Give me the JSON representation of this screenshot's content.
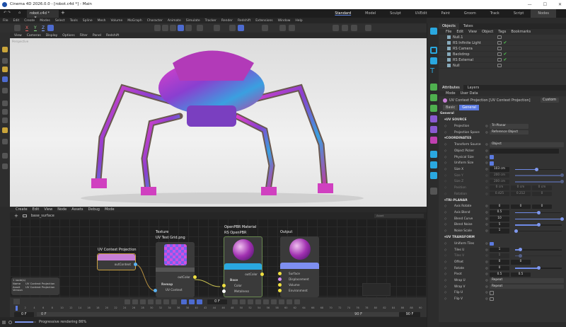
{
  "title": "Cinema 4D 2026.0.0 - [robot.c4d *] - Main",
  "doc_tab": "robot.c4d *",
  "layouts": [
    "Standard",
    "Model",
    "Sculpt",
    "UVEdit",
    "Paint",
    "Groom",
    "Track",
    "Script",
    "Nodes"
  ],
  "menu": [
    "File",
    "Edit",
    "Create",
    "Modes",
    "Select",
    "Tools",
    "Spline",
    "Mesh",
    "Volume",
    "MoGraph",
    "Character",
    "Animate",
    "Simulate",
    "Tracker",
    "Render",
    "Redshift",
    "Extensions",
    "Window",
    "Help"
  ],
  "axis": {
    "x": "X",
    "y": "Y",
    "z": "Z"
  },
  "viewport_menu": [
    "View",
    "Cameras",
    "Display",
    "Options",
    "Filter",
    "Panel",
    "Redshift"
  ],
  "viewport_label": "Perspective",
  "objects": {
    "tabs": [
      "Objects",
      "Takes"
    ],
    "menu": [
      "File",
      "Edit",
      "View",
      "Object",
      "Tags",
      "Bookmarks"
    ],
    "items": [
      {
        "name": "Null.1",
        "check": false
      },
      {
        "name": "RS Infinite Light",
        "check": true
      },
      {
        "name": "RS Camera",
        "check": false
      },
      {
        "name": "Backdrop",
        "check": true
      },
      {
        "name": "RS External",
        "check": true
      },
      {
        "name": "Null",
        "check": false
      }
    ]
  },
  "attributes": {
    "tabs": [
      "Attributes",
      "Layers"
    ],
    "menu": [
      "Mode",
      "User Data"
    ],
    "object": "UV Context Projection [UV Context Projection]",
    "preset": "Custom",
    "subtabs": [
      "Basic",
      "General"
    ],
    "group": "General",
    "uv_source": {
      "title": "UV SOURCE",
      "projection_label": "Projection",
      "projection": "Tri-Planar",
      "space_label": "Projection Space",
      "space": "Reference Object"
    },
    "coordinates": {
      "title": "COORDINATES",
      "transform_source_label": "Transform Source",
      "transform_source": "Object",
      "object_picker_label": "Object Picker",
      "physical_size_label": "Physical Size",
      "uniform_size_label": "Uniform Size",
      "size_x_label": "Size X",
      "size_x": "103 cm",
      "size_y_label": "Size Y",
      "size_y": "200 cm",
      "size_z_label": "Size Z",
      "size_z": "200 cm",
      "position_label": "Position",
      "position": [
        "0 cm",
        "0 cm",
        "0 cm"
      ],
      "rotation_label": "Rotation",
      "rotation": [
        "0.425",
        "0.212",
        "0"
      ]
    },
    "triplanar": {
      "title": "TRI-PLANAR",
      "axis_rotate_label": "Axis Rotate",
      "axis_rotate": [
        "0",
        "0",
        "0"
      ],
      "axis_blend_label": "Axis Blend",
      "axis_blend": "0.5",
      "blend_curve_label": "Blend Curve",
      "blend_curve": "10",
      "blend_noise_label": "Blend Noise",
      "blend_noise": "5",
      "noise_scale_label": "Noise Scale",
      "noise_scale": "1"
    },
    "uv_transform": {
      "title": "UV TRANSFORM",
      "uniform_tiles_label": "Uniform Tiles",
      "tiles_u_label": "Tiles U",
      "tiles_u": "1",
      "tiles_v_label": "Tiles V",
      "tiles_v": "1",
      "offset_label": "Offset",
      "offset": [
        "0",
        "0"
      ],
      "rotate_label": "Rotate",
      "rotate": "0",
      "pivot_label": "Pivot",
      "pivot": [
        "0.5",
        "0.5"
      ],
      "wrap_u_label": "Wrap U",
      "wrap_u": "Repeat",
      "wrap_v_label": "Wrap V",
      "wrap_v": "Repeat",
      "flip_u_label": "Flip U",
      "flip_v_label": "Flip V"
    }
  },
  "node_editor": {
    "menu": [
      "Create",
      "Edit",
      "View",
      "Node",
      "Assets",
      "Debug",
      "Mode"
    ],
    "path": "base_surface",
    "search_placeholder": "Asset",
    "nodes": {
      "uvctx": {
        "title": "UV Context Projection",
        "out": "outContext"
      },
      "texture": {
        "type": "Texture",
        "title": "UV Test Grid.png",
        "out": "outColor",
        "group": "Remap",
        "in": "UV Context"
      },
      "pbr": {
        "type": "OpenPBR Material",
        "title": "RS OpenPBR",
        "out": "outColor",
        "group": "Base",
        "inputs": [
          "Color",
          "Metalness"
        ]
      },
      "output": {
        "title": "Output",
        "inputs": [
          "Surface",
          "Displacement",
          "Volume",
          "Environment"
        ]
      }
    },
    "info": {
      "count": "1 node(s)",
      "name_label": "Name",
      "name": "UV Context Projection",
      "asset_label": "Asset",
      "asset": "UV Context Projection",
      "version_label": "Version"
    }
  },
  "timeline": {
    "ticks": [
      0,
      2,
      4,
      6,
      8,
      10,
      12,
      14,
      16,
      18,
      20,
      22,
      24,
      26,
      28,
      30,
      32,
      34,
      36,
      38,
      40,
      42,
      44,
      46,
      48,
      50,
      52,
      54,
      56,
      58,
      60,
      62,
      64,
      66,
      68,
      70,
      72,
      74,
      76,
      78,
      80,
      82,
      84,
      86,
      88,
      90
    ],
    "current": "0 F",
    "start": "0 F",
    "start2": "0 F",
    "end": "90 F",
    "end2": "90 F"
  },
  "status": {
    "text": "Progressive rendering 86%",
    "progress": 86
  },
  "colors": {
    "accent": "#5b7ae0",
    "node_uv": "#c77fd6",
    "node_pbr": "#2aa8e0",
    "node_out": "#7e8ff0"
  }
}
